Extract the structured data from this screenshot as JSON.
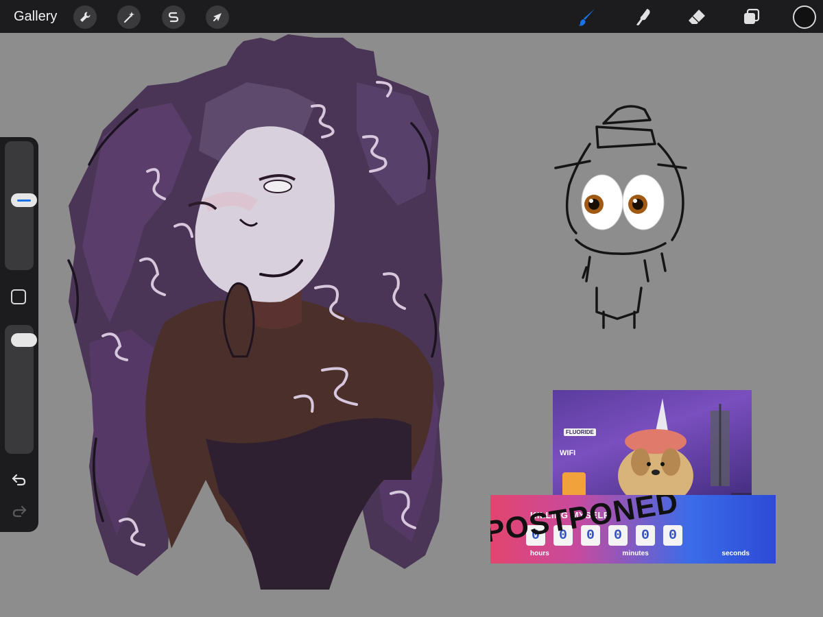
{
  "topbar": {
    "gallery_label": "Gallery",
    "actions": [
      {
        "name": "actions-button",
        "icon": "wrench-icon"
      },
      {
        "name": "adjustments-button",
        "icon": "magic-wand-icon"
      },
      {
        "name": "selection-button",
        "icon": "selection-s-icon"
      },
      {
        "name": "transform-button",
        "icon": "arrow-cursor-icon"
      }
    ],
    "tools": [
      {
        "name": "brush-tool",
        "icon": "brush-icon",
        "active": true
      },
      {
        "name": "smudge-tool",
        "icon": "smudge-icon",
        "active": false
      },
      {
        "name": "eraser-tool",
        "icon": "eraser-icon",
        "active": false
      },
      {
        "name": "layers-button",
        "icon": "layers-icon",
        "active": false
      }
    ],
    "accent_color": "#1a73e8",
    "current_color": "#111111"
  },
  "sidebar": {
    "brush_size_level": 0.55,
    "opacity_level": 0.95,
    "undo_icon": "undo-icon",
    "redo_icon": "redo-icon"
  },
  "meme": {
    "caption": "KILLING MYSELF",
    "wifi": "WIFI",
    "fluoride": "FLUORIDE",
    "timer_digits": [
      "0",
      "0",
      "0",
      "0",
      "0",
      "0"
    ],
    "timer_labels": [
      "hours",
      "minutes",
      "seconds"
    ],
    "stamp": "POSTPONED"
  }
}
